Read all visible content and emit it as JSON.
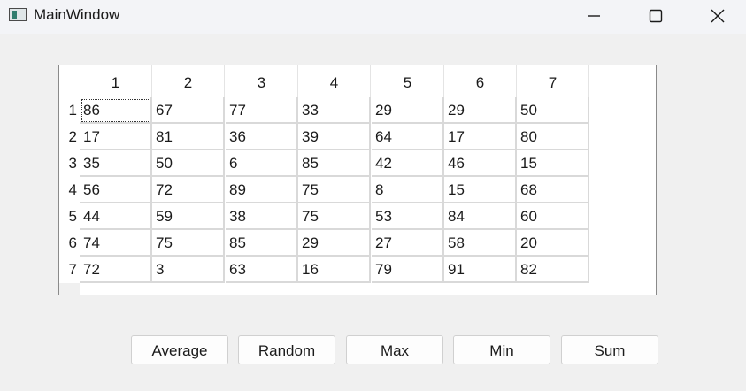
{
  "window": {
    "title": "MainWindow"
  },
  "table": {
    "column_headers": [
      "1",
      "2",
      "3",
      "4",
      "5",
      "6",
      "7"
    ],
    "row_headers": [
      "1",
      "2",
      "3",
      "4",
      "5",
      "6",
      "7"
    ],
    "rows": [
      [
        "86",
        "67",
        "77",
        "33",
        "29",
        "29",
        "50"
      ],
      [
        "17",
        "81",
        "36",
        "39",
        "64",
        "17",
        "80"
      ],
      [
        "35",
        "50",
        "6",
        "85",
        "42",
        "46",
        "15"
      ],
      [
        "56",
        "72",
        "89",
        "75",
        "8",
        "15",
        "68"
      ],
      [
        "44",
        "59",
        "38",
        "75",
        "53",
        "84",
        "60"
      ],
      [
        "74",
        "75",
        "85",
        "29",
        "27",
        "58",
        "20"
      ],
      [
        "72",
        "3",
        "63",
        "16",
        "79",
        "91",
        "82"
      ]
    ],
    "current_cell": [
      0,
      0
    ]
  },
  "buttons": {
    "average": "Average",
    "random": "Random",
    "max": "Max",
    "min": "Min",
    "sum": "Sum"
  }
}
